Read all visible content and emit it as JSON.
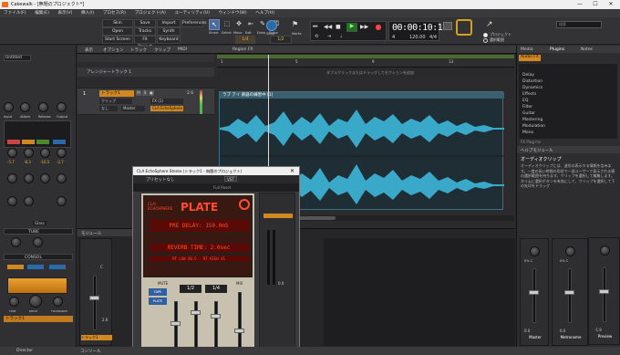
{
  "window": {
    "title": "Cakewalk - [無題のプロジェクト*]",
    "min": "—",
    "max": "☐",
    "close": "✕"
  },
  "menu": [
    "ファイル(F)",
    "編集(E)",
    "表示(V)",
    "挿入(I)",
    "プロセス(R)",
    "プロジェクト(A)",
    "ユーティリティ(U)",
    "ウィンドウ(W)",
    "ヘルプ(H)"
  ],
  "toolbar": {
    "skins": [
      "Skin",
      "Open",
      "Start Screen"
    ],
    "save": [
      "Save",
      "Tracks",
      "Fit Project"
    ],
    "import": [
      "Import",
      "Synth Rack",
      "Keyboard"
    ],
    "prefs": "Preferences",
    "tools": [
      "Smart",
      "Select",
      "Move",
      "Edit",
      "Draw",
      "Erase"
    ],
    "snap": "1/4",
    "snap_label": "Snap",
    "snap_val": "1/2",
    "marks": "Marks",
    "time": "00:00:10:15",
    "tempo": "120.00",
    "meter": "4/4",
    "key": "4",
    "search_placeholder": "検索",
    "project_opt": "プロジェクト",
    "select_opt": "選択範囲"
  },
  "inspector": {
    "preset": "Untitled",
    "tube": "TUBE",
    "console": "CONSOL",
    "track_label": "トラック1",
    "knobs": [
      "Input",
      "Attack",
      "Release",
      "Output"
    ],
    "values": [
      "-5.7",
      "-8.3",
      "-16.5",
      "-2.7"
    ],
    "mode": "Glass",
    "mode2": "Gain",
    "drive_labels": [
      "TRIM",
      "DRIVE",
      "TOLERANCE"
    ],
    "pan": "C",
    "vol": "0.0"
  },
  "tracks": {
    "toolbar": [
      "表示",
      "オプション",
      "トラック",
      "クリップ",
      "MIDI"
    ],
    "region": "Region FX",
    "arranger": "アレンジャートラック 1",
    "track_name": "トラック1",
    "track_num": "1",
    "vol": "2.6",
    "input": "クリップ",
    "fx": "FX (1)",
    "master": "Master",
    "fx_name": "CLA EchoSphere",
    "none": "なし",
    "clip_name": "ラブ アイ 楽器の練習中 [1]",
    "ruler_hint": "ダブルクリックまたはドラッグしてセクションを追加",
    "ruler_labels": [
      "1",
      "5",
      "9",
      "13"
    ]
  },
  "browser": {
    "tabs": [
      "Media",
      "Plugins",
      "Notes"
    ],
    "filter": "Audio FX",
    "items": [
      "Delay",
      "Distortion",
      "Dynamics",
      "Effects",
      "EQ",
      "Filter",
      "Guitar",
      "Mastering",
      "Modulation",
      "Mono"
    ],
    "plugin_count": "FX Plug-ins",
    "help_title": "ヘルプモジュール",
    "help_heading": "オーディオクリップ",
    "help_text": "オーディオクリップには、波形の表示する情報を含みます。一度の長い時間の形状で一部ユーザーで表示される値の選択範囲を持ちます。クリップを選択して編集します。タイムに選択ボタンを有効にして、クリップを選択して下の矢印をドラッグ"
  },
  "plugin": {
    "title": "CLA EchoSphere Stereo (トラック1 - 無題のプロジェクト)",
    "preset": "プリセットなし",
    "full_preset": "Full Reset",
    "brand_top": "CLA/",
    "brand_bottom": "ECHOSPHERE",
    "name": "PLATE",
    "lcd1": "PRE DELAY: 150.0mS",
    "lcd2": "REVERB TIME: 2.0sec",
    "lcd3": "RT LOW X0.5 · RT HIGH X1",
    "mute": "MUTE",
    "mix": "MIX",
    "tape_label": "TAPE",
    "plate_label": "PLATE",
    "val1": "1/2",
    "val2": "1/4",
    "wet": "0.0"
  },
  "console": {
    "module": "モジュール",
    "strips": [
      "Master",
      "Metronome",
      "Preview"
    ],
    "vol": "0.0",
    "db": [
      "2.6",
      "0.0",
      "-1.9"
    ],
    "pan": "0% C"
  },
  "status": {
    "left": "Director",
    "right": "コンソール"
  }
}
